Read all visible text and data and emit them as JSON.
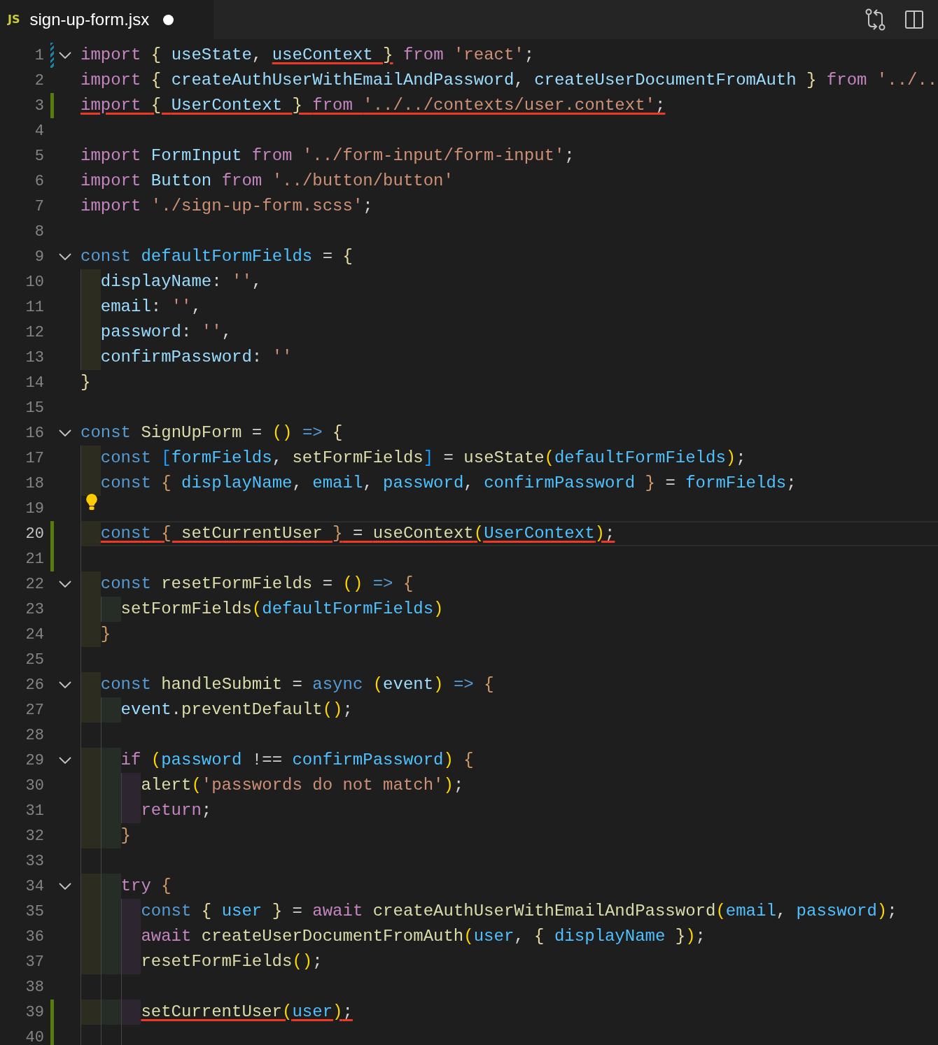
{
  "tab": {
    "icon_text": "JS",
    "label": "sign-up-form.jsx",
    "dirty": true,
    "selected": true
  },
  "lines": [
    {
      "number": "1",
      "added": false,
      "modified": true,
      "foldable": true,
      "current": false,
      "lightbulb": false,
      "spans": [
        {
          "struck": false,
          "tokens": [
            {
              "text": "import ",
              "kind": "kw"
            },
            {
              "text": "{ ",
              "kind": "l"
            },
            {
              "text": "useState",
              "kind": "v"
            },
            {
              "text": ", ",
              "kind": "p"
            }
          ]
        },
        {
          "struck": true,
          "tokens": [
            {
              "text": "useContext ",
              "kind": "v"
            },
            {
              "text": "}",
              "kind": "l"
            }
          ]
        },
        {
          "struck": false,
          "tokens": [
            {
              "text": " from ",
              "kind": "kw"
            },
            {
              "text": "'react'",
              "kind": "s"
            },
            {
              "text": ";",
              "kind": "p"
            }
          ]
        }
      ]
    },
    {
      "number": "2",
      "added": false,
      "modified": false,
      "foldable": false,
      "current": false,
      "lightbulb": false,
      "spans": [
        {
          "struck": false,
          "tokens": [
            {
              "text": "import ",
              "kind": "kw"
            },
            {
              "text": "{ ",
              "kind": "l"
            },
            {
              "text": "createAuthUserWithEmailAndPassword",
              "kind": "v"
            },
            {
              "text": ", ",
              "kind": "p"
            },
            {
              "text": "createUserDocumentFromAuth ",
              "kind": "v"
            },
            {
              "text": "} ",
              "kind": "l"
            },
            {
              "text": "from ",
              "kind": "kw"
            },
            {
              "text": "'../..",
              "kind": "s"
            }
          ]
        }
      ]
    },
    {
      "number": "3",
      "added": true,
      "modified": false,
      "foldable": false,
      "current": false,
      "lightbulb": false,
      "spans": [
        {
          "struck": true,
          "tokens": [
            {
              "text": "import ",
              "kind": "kw"
            },
            {
              "text": "{ ",
              "kind": "l"
            },
            {
              "text": "UserContext ",
              "kind": "v"
            },
            {
              "text": "} ",
              "kind": "l"
            },
            {
              "text": "from ",
              "kind": "kw"
            },
            {
              "text": "'../../contexts/user.context'",
              "kind": "s"
            },
            {
              "text": ";",
              "kind": "p"
            }
          ]
        }
      ]
    },
    {
      "number": "4",
      "added": false,
      "modified": false,
      "foldable": false,
      "current": false,
      "lightbulb": false
    },
    {
      "number": "5",
      "added": false,
      "modified": false,
      "foldable": false,
      "current": false,
      "lightbulb": false,
      "spans": [
        {
          "struck": false,
          "tokens": [
            {
              "text": "import ",
              "kind": "kw"
            },
            {
              "text": "FormInput ",
              "kind": "v"
            },
            {
              "text": "from ",
              "kind": "kw"
            },
            {
              "text": "'../form-input/form-input'",
              "kind": "s"
            },
            {
              "text": ";",
              "kind": "p"
            }
          ]
        }
      ]
    },
    {
      "number": "6",
      "added": false,
      "modified": false,
      "foldable": false,
      "current": false,
      "lightbulb": false,
      "spans": [
        {
          "struck": false,
          "tokens": [
            {
              "text": "import ",
              "kind": "kw"
            },
            {
              "text": "Button ",
              "kind": "v"
            },
            {
              "text": "from ",
              "kind": "kw"
            },
            {
              "text": "'../button/button'",
              "kind": "s"
            }
          ]
        }
      ]
    },
    {
      "number": "7",
      "added": false,
      "modified": false,
      "foldable": false,
      "current": false,
      "lightbulb": false,
      "spans": [
        {
          "struck": false,
          "tokens": [
            {
              "text": "import ",
              "kind": "kw"
            },
            {
              "text": "'./sign-up-form.scss'",
              "kind": "s"
            },
            {
              "text": ";",
              "kind": "p"
            }
          ]
        }
      ]
    },
    {
      "number": "8",
      "added": false,
      "modified": false,
      "foldable": false,
      "current": false,
      "lightbulb": false
    },
    {
      "number": "9",
      "added": false,
      "modified": false,
      "foldable": true,
      "current": false,
      "lightbulb": false,
      "spans": [
        {
          "struck": false,
          "tokens": [
            {
              "text": "const ",
              "kind": "st"
            },
            {
              "text": "defaultFormFields",
              "kind": "c"
            },
            {
              "text": " = ",
              "kind": "p"
            },
            {
              "text": "{",
              "kind": "l"
            }
          ]
        }
      ]
    },
    {
      "number": "10",
      "added": false,
      "modified": false,
      "foldable": false,
      "current": false,
      "lightbulb": false,
      "spans": [
        {
          "struck": false,
          "tokens": [
            {
              "text": "  displayName",
              "kind": "v"
            },
            {
              "text": ": ",
              "kind": "p"
            },
            {
              "text": "''",
              "kind": "s"
            },
            {
              "text": ",",
              "kind": "p"
            }
          ]
        }
      ]
    },
    {
      "number": "11",
      "added": false,
      "modified": false,
      "foldable": false,
      "current": false,
      "lightbulb": false,
      "spans": [
        {
          "struck": false,
          "tokens": [
            {
              "text": "  email",
              "kind": "v"
            },
            {
              "text": ": ",
              "kind": "p"
            },
            {
              "text": "''",
              "kind": "s"
            },
            {
              "text": ",",
              "kind": "p"
            }
          ]
        }
      ]
    },
    {
      "number": "12",
      "added": false,
      "modified": false,
      "foldable": false,
      "current": false,
      "lightbulb": false,
      "spans": [
        {
          "struck": false,
          "tokens": [
            {
              "text": "  password",
              "kind": "v"
            },
            {
              "text": ": ",
              "kind": "p"
            },
            {
              "text": "''",
              "kind": "s"
            },
            {
              "text": ",",
              "kind": "p"
            }
          ]
        }
      ]
    },
    {
      "number": "13",
      "added": false,
      "modified": false,
      "foldable": false,
      "current": false,
      "lightbulb": false,
      "spans": [
        {
          "struck": false,
          "tokens": [
            {
              "text": "  confirmPassword",
              "kind": "v"
            },
            {
              "text": ": ",
              "kind": "p"
            },
            {
              "text": "''",
              "kind": "s"
            }
          ]
        }
      ]
    },
    {
      "number": "14",
      "added": false,
      "modified": false,
      "foldable": false,
      "current": false,
      "lightbulb": false,
      "spans": [
        {
          "struck": false,
          "tokens": [
            {
              "text": "}",
              "kind": "l"
            }
          ]
        }
      ]
    },
    {
      "number": "15",
      "added": false,
      "modified": false,
      "foldable": false,
      "current": false,
      "lightbulb": false
    },
    {
      "number": "16",
      "added": false,
      "modified": false,
      "foldable": true,
      "current": false,
      "lightbulb": false,
      "spans": [
        {
          "struck": false,
          "tokens": [
            {
              "text": "const ",
              "kind": "st"
            },
            {
              "text": "SignUpForm",
              "kind": "f"
            },
            {
              "text": " = ",
              "kind": "p"
            },
            {
              "text": "() ",
              "kind": "y"
            },
            {
              "text": "=> ",
              "kind": "st"
            },
            {
              "text": "{",
              "kind": "l"
            }
          ]
        }
      ]
    },
    {
      "number": "17",
      "added": false,
      "modified": false,
      "foldable": false,
      "current": false,
      "lightbulb": false,
      "spans": [
        {
          "struck": false,
          "tokens": [
            {
              "text": "  const ",
              "kind": "st"
            },
            {
              "text": "[",
              "kind": "b"
            },
            {
              "text": "formFields",
              "kind": "c"
            },
            {
              "text": ", ",
              "kind": "p"
            },
            {
              "text": "setFormFields",
              "kind": "f"
            },
            {
              "text": "]",
              "kind": "b"
            },
            {
              "text": " = ",
              "kind": "p"
            },
            {
              "text": "useState",
              "kind": "f"
            },
            {
              "text": "(",
              "kind": "y"
            },
            {
              "text": "defaultFormFields",
              "kind": "c"
            },
            {
              "text": ")",
              "kind": "y"
            },
            {
              "text": ";",
              "kind": "p"
            }
          ]
        }
      ]
    },
    {
      "number": "18",
      "added": false,
      "modified": false,
      "foldable": false,
      "current": false,
      "lightbulb": false,
      "spans": [
        {
          "struck": false,
          "tokens": [
            {
              "text": "  const ",
              "kind": "st"
            },
            {
              "text": "{ ",
              "kind": "o"
            },
            {
              "text": "displayName",
              "kind": "c"
            },
            {
              "text": ", ",
              "kind": "p"
            },
            {
              "text": "email",
              "kind": "c"
            },
            {
              "text": ", ",
              "kind": "p"
            },
            {
              "text": "password",
              "kind": "c"
            },
            {
              "text": ", ",
              "kind": "p"
            },
            {
              "text": "confirmPassword ",
              "kind": "c"
            },
            {
              "text": "}",
              "kind": "o"
            },
            {
              "text": " = ",
              "kind": "p"
            },
            {
              "text": "formFields",
              "kind": "c"
            },
            {
              "text": ";",
              "kind": "p"
            }
          ]
        }
      ]
    },
    {
      "number": "19",
      "added": false,
      "modified": false,
      "foldable": false,
      "current": false,
      "lightbulb": true
    },
    {
      "number": "20",
      "added": true,
      "modified": false,
      "foldable": false,
      "current": true,
      "lightbulb": false,
      "spans": [
        {
          "struck": true,
          "tokens": [
            {
              "text": "  const ",
              "kind": "st"
            },
            {
              "text": "{ ",
              "kind": "o"
            },
            {
              "text": "setCurrentUser ",
              "kind": "f"
            },
            {
              "text": "}",
              "kind": "o"
            },
            {
              "text": " = ",
              "kind": "p"
            },
            {
              "text": "useContext",
              "kind": "f"
            },
            {
              "text": "(",
              "kind": "y"
            },
            {
              "text": "UserContext",
              "kind": "c"
            },
            {
              "text": ")",
              "kind": "y"
            },
            {
              "text": ";",
              "kind": "p"
            }
          ]
        }
      ]
    },
    {
      "number": "21",
      "added": true,
      "modified": false,
      "foldable": false,
      "current": false,
      "lightbulb": false
    },
    {
      "number": "22",
      "added": false,
      "modified": false,
      "foldable": true,
      "current": false,
      "lightbulb": false,
      "spans": [
        {
          "struck": false,
          "tokens": [
            {
              "text": "  const ",
              "kind": "st"
            },
            {
              "text": "resetFormFields",
              "kind": "f"
            },
            {
              "text": " = ",
              "kind": "p"
            },
            {
              "text": "() ",
              "kind": "y"
            },
            {
              "text": "=> ",
              "kind": "st"
            },
            {
              "text": "{",
              "kind": "o"
            }
          ]
        }
      ]
    },
    {
      "number": "23",
      "added": false,
      "modified": false,
      "foldable": false,
      "current": false,
      "lightbulb": false,
      "spans": [
        {
          "struck": false,
          "tokens": [
            {
              "text": "    setFormFields",
              "kind": "f"
            },
            {
              "text": "(",
              "kind": "y"
            },
            {
              "text": "defaultFormFields",
              "kind": "c"
            },
            {
              "text": ")",
              "kind": "y"
            }
          ]
        }
      ]
    },
    {
      "number": "24",
      "added": false,
      "modified": false,
      "foldable": false,
      "current": false,
      "lightbulb": false,
      "spans": [
        {
          "struck": false,
          "tokens": [
            {
              "text": "  }",
              "kind": "o"
            }
          ]
        }
      ]
    },
    {
      "number": "25",
      "added": false,
      "modified": false,
      "foldable": false,
      "current": false,
      "lightbulb": false
    },
    {
      "number": "26",
      "added": false,
      "modified": false,
      "foldable": true,
      "current": false,
      "lightbulb": false,
      "spans": [
        {
          "struck": false,
          "tokens": [
            {
              "text": "  const ",
              "kind": "st"
            },
            {
              "text": "handleSubmit",
              "kind": "f"
            },
            {
              "text": " = ",
              "kind": "p"
            },
            {
              "text": "async ",
              "kind": "st"
            },
            {
              "text": "(",
              "kind": "y"
            },
            {
              "text": "event",
              "kind": "v"
            },
            {
              "text": ") ",
              "kind": "y"
            },
            {
              "text": "=> ",
              "kind": "st"
            },
            {
              "text": "{",
              "kind": "o"
            }
          ]
        }
      ]
    },
    {
      "number": "27",
      "added": false,
      "modified": false,
      "foldable": false,
      "current": false,
      "lightbulb": false,
      "spans": [
        {
          "struck": false,
          "tokens": [
            {
              "text": "    event",
              "kind": "v"
            },
            {
              "text": ".",
              "kind": "p"
            },
            {
              "text": "preventDefault",
              "kind": "f"
            },
            {
              "text": "()",
              "kind": "y"
            },
            {
              "text": ";",
              "kind": "p"
            }
          ]
        }
      ]
    },
    {
      "number": "28",
      "added": false,
      "modified": false,
      "foldable": false,
      "current": false,
      "lightbulb": false
    },
    {
      "number": "29",
      "added": false,
      "modified": false,
      "foldable": true,
      "current": false,
      "lightbulb": false,
      "spans": [
        {
          "struck": false,
          "tokens": [
            {
              "text": "    if ",
              "kind": "kw"
            },
            {
              "text": "(",
              "kind": "y"
            },
            {
              "text": "password",
              "kind": "c"
            },
            {
              "text": " !== ",
              "kind": "p"
            },
            {
              "text": "confirmPassword",
              "kind": "c"
            },
            {
              "text": ") ",
              "kind": "y"
            },
            {
              "text": "{",
              "kind": "o"
            }
          ]
        }
      ]
    },
    {
      "number": "30",
      "added": false,
      "modified": false,
      "foldable": false,
      "current": false,
      "lightbulb": false,
      "spans": [
        {
          "struck": false,
          "tokens": [
            {
              "text": "      alert",
              "kind": "f"
            },
            {
              "text": "(",
              "kind": "y"
            },
            {
              "text": "'passwords do not match'",
              "kind": "s"
            },
            {
              "text": ")",
              "kind": "y"
            },
            {
              "text": ";",
              "kind": "p"
            }
          ]
        }
      ]
    },
    {
      "number": "31",
      "added": false,
      "modified": false,
      "foldable": false,
      "current": false,
      "lightbulb": false,
      "spans": [
        {
          "struck": false,
          "tokens": [
            {
              "text": "      return",
              "kind": "kw"
            },
            {
              "text": ";",
              "kind": "p"
            }
          ]
        }
      ]
    },
    {
      "number": "32",
      "added": false,
      "modified": false,
      "foldable": false,
      "current": false,
      "lightbulb": false,
      "spans": [
        {
          "struck": false,
          "tokens": [
            {
              "text": "    }",
              "kind": "o"
            }
          ]
        }
      ]
    },
    {
      "number": "33",
      "added": false,
      "modified": false,
      "foldable": false,
      "current": false,
      "lightbulb": false
    },
    {
      "number": "34",
      "added": false,
      "modified": false,
      "foldable": true,
      "current": false,
      "lightbulb": false,
      "spans": [
        {
          "struck": false,
          "tokens": [
            {
              "text": "    try ",
              "kind": "kw"
            },
            {
              "text": "{",
              "kind": "o"
            }
          ]
        }
      ]
    },
    {
      "number": "35",
      "added": false,
      "modified": false,
      "foldable": false,
      "current": false,
      "lightbulb": false,
      "spans": [
        {
          "struck": false,
          "tokens": [
            {
              "text": "      const ",
              "kind": "st"
            },
            {
              "text": "{ ",
              "kind": "l"
            },
            {
              "text": "user ",
              "kind": "c"
            },
            {
              "text": "}",
              "kind": "l"
            },
            {
              "text": " = ",
              "kind": "p"
            },
            {
              "text": "await ",
              "kind": "kw"
            },
            {
              "text": "createAuthUserWithEmailAndPassword",
              "kind": "f"
            },
            {
              "text": "(",
              "kind": "y"
            },
            {
              "text": "email",
              "kind": "c"
            },
            {
              "text": ", ",
              "kind": "p"
            },
            {
              "text": "password",
              "kind": "c"
            },
            {
              "text": ")",
              "kind": "y"
            },
            {
              "text": ";",
              "kind": "p"
            }
          ]
        }
      ]
    },
    {
      "number": "36",
      "added": false,
      "modified": false,
      "foldable": false,
      "current": false,
      "lightbulb": false,
      "spans": [
        {
          "struck": false,
          "tokens": [
            {
              "text": "      await ",
              "kind": "kw"
            },
            {
              "text": "createUserDocumentFromAuth",
              "kind": "f"
            },
            {
              "text": "(",
              "kind": "y"
            },
            {
              "text": "user",
              "kind": "c"
            },
            {
              "text": ", ",
              "kind": "p"
            },
            {
              "text": "{ ",
              "kind": "l"
            },
            {
              "text": "displayName ",
              "kind": "c"
            },
            {
              "text": "}",
              "kind": "l"
            },
            {
              "text": ")",
              "kind": "y"
            },
            {
              "text": ";",
              "kind": "p"
            }
          ]
        }
      ]
    },
    {
      "number": "37",
      "added": false,
      "modified": false,
      "foldable": false,
      "current": false,
      "lightbulb": false,
      "spans": [
        {
          "struck": false,
          "tokens": [
            {
              "text": "      resetFormFields",
              "kind": "f"
            },
            {
              "text": "()",
              "kind": "y"
            },
            {
              "text": ";",
              "kind": "p"
            }
          ]
        }
      ]
    },
    {
      "number": "38",
      "added": false,
      "modified": false,
      "foldable": false,
      "current": false,
      "lightbulb": false
    },
    {
      "number": "39",
      "added": true,
      "modified": false,
      "foldable": false,
      "current": false,
      "lightbulb": false,
      "spans": [
        {
          "struck": true,
          "tokens": [
            {
              "text": "      setCurrentUser",
              "kind": "f"
            },
            {
              "text": "(",
              "kind": "y"
            },
            {
              "text": "user",
              "kind": "c"
            },
            {
              "text": ")",
              "kind": "y"
            },
            {
              "text": ";",
              "kind": "p"
            }
          ]
        }
      ]
    },
    {
      "number": "40",
      "added": true,
      "modified": false,
      "foldable": false,
      "current": false,
      "lightbulb": false
    }
  ]
}
